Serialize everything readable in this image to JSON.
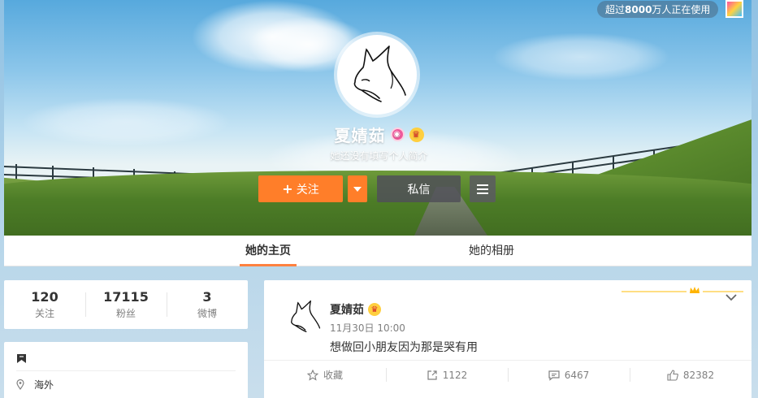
{
  "top_hint": {
    "prefix": "超过",
    "count": "8000",
    "suffix": "万人正在使用"
  },
  "profile": {
    "name": "夏婧茹",
    "bio": "她还没有填写个人简介",
    "follow_label": "关注",
    "message_label": "私信"
  },
  "tabs": [
    {
      "label": "她的主页",
      "active": true
    },
    {
      "label": "她的相册",
      "active": false
    }
  ],
  "stats": [
    {
      "value": "120",
      "label": "关注"
    },
    {
      "value": "17115",
      "label": "粉丝"
    },
    {
      "value": "3",
      "label": "微博"
    }
  ],
  "info": {
    "location": "海外"
  },
  "post": {
    "author": "夏婧茹",
    "time": "11月30日 10:00",
    "text": "想做回小朋友因为那是哭有用",
    "actions": [
      {
        "icon": "star-icon",
        "label": "收藏"
      },
      {
        "icon": "share-icon",
        "label": "1122"
      },
      {
        "icon": "comment-icon",
        "label": "6467"
      },
      {
        "icon": "like-icon",
        "label": "82382"
      }
    ]
  },
  "colors": {
    "accent": "#ff7e29",
    "tab_underline": "#ff8140",
    "pink_badge": "#f05a9c",
    "gold": "#ffcf3f"
  }
}
